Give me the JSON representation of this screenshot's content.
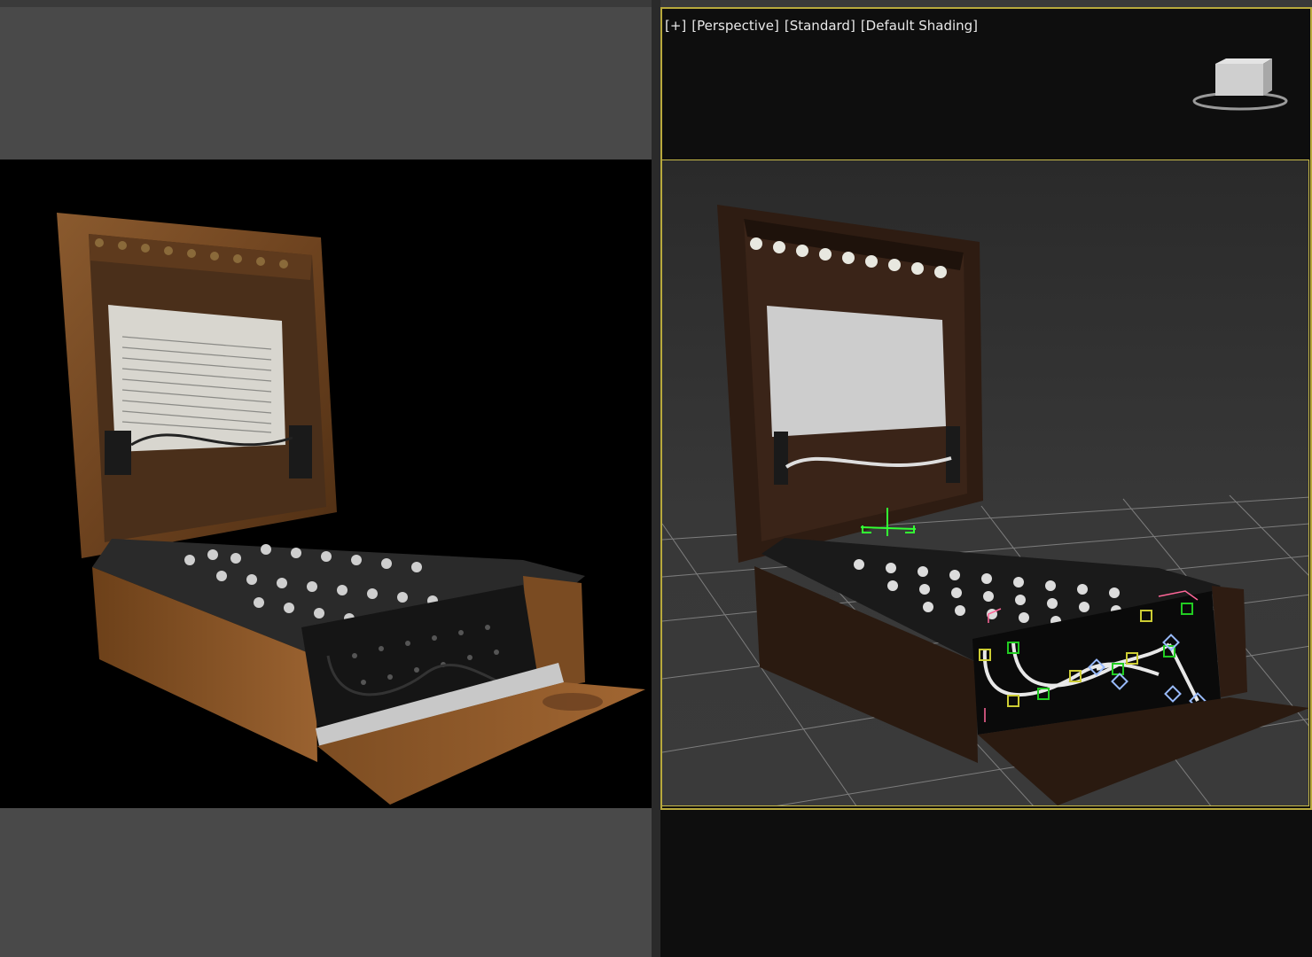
{
  "viewport": {
    "menu_plus": "[+]",
    "view": "[Perspective]",
    "standard": "[Standard]",
    "shading": "[Default Shading]"
  },
  "viewcube": {
    "label": "ViewCube",
    "icon": "viewcube-icon"
  },
  "panes": {
    "left": {
      "content": "render-image"
    },
    "right": {
      "content": "perspective-viewport"
    }
  },
  "colors": {
    "viewport_border": "#b8a93c",
    "safe_frame": "#c9bb4a",
    "viewport_bg": "#0e0e0e",
    "render_bg": "#000000",
    "gizmo_green": "#33ff33",
    "helper_green": "#22cc22",
    "helper_yellow": "#cccc33",
    "helper_blue": "#99bbff"
  }
}
